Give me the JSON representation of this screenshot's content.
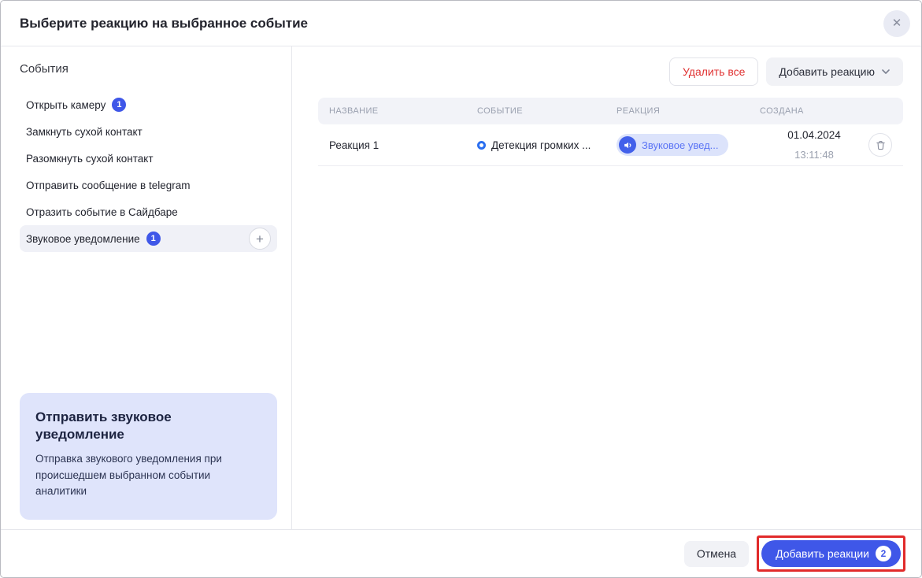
{
  "modal": {
    "title": "Выберите реакцию на выбранное событие",
    "close_glyph": "✕"
  },
  "sidebar": {
    "title": "События",
    "items": [
      {
        "label": "Открыть камеру",
        "badge": "1"
      },
      {
        "label": "Замкнуть сухой контакт"
      },
      {
        "label": "Разомкнуть сухой контакт"
      },
      {
        "label": "Отправить сообщение в telegram"
      },
      {
        "label": "Отразить событие в Сайдбаре"
      },
      {
        "label": "Звуковое уведомление",
        "badge": "1",
        "selected": true,
        "add_glyph": "+"
      }
    ],
    "info_card": {
      "title": "Отправить звуковое уведомление",
      "description": "Отправка звукового уведомления при происшедшем выбранном событии аналитики"
    }
  },
  "toolbar": {
    "delete_all_label": "Удалить все",
    "add_reaction_label": "Добавить реакцию",
    "chevron_icon": "chevron-down"
  },
  "table": {
    "headers": [
      "НАЗВАНИЕ",
      "СОБЫТИЕ",
      "РЕАКЦИЯ",
      "СОЗДАНА"
    ],
    "rows": [
      {
        "name": "Реакция 1",
        "event": "Детекция громких ...",
        "event_icon": "ring-icon",
        "reaction": "Звуковое увед...",
        "reaction_icon": "sound-notification-icon",
        "created_date": "01.04.2024",
        "created_time": "13:11:48",
        "delete_icon": "trash-icon"
      }
    ]
  },
  "footer": {
    "cancel_label": "Отмена",
    "submit_label": "Добавить реакции",
    "submit_badge": "2"
  },
  "colors": {
    "accent_blue": "#3f57e8",
    "pill_bg": "#dce3fb",
    "pill_text": "#5b74f5",
    "danger_red": "#e03131",
    "annotation_red": "#e12a2a",
    "selected_item_bg": "#f0f1f7",
    "info_card_bg": "#dfe4fb",
    "table_header_bg": "#f2f3f8"
  }
}
